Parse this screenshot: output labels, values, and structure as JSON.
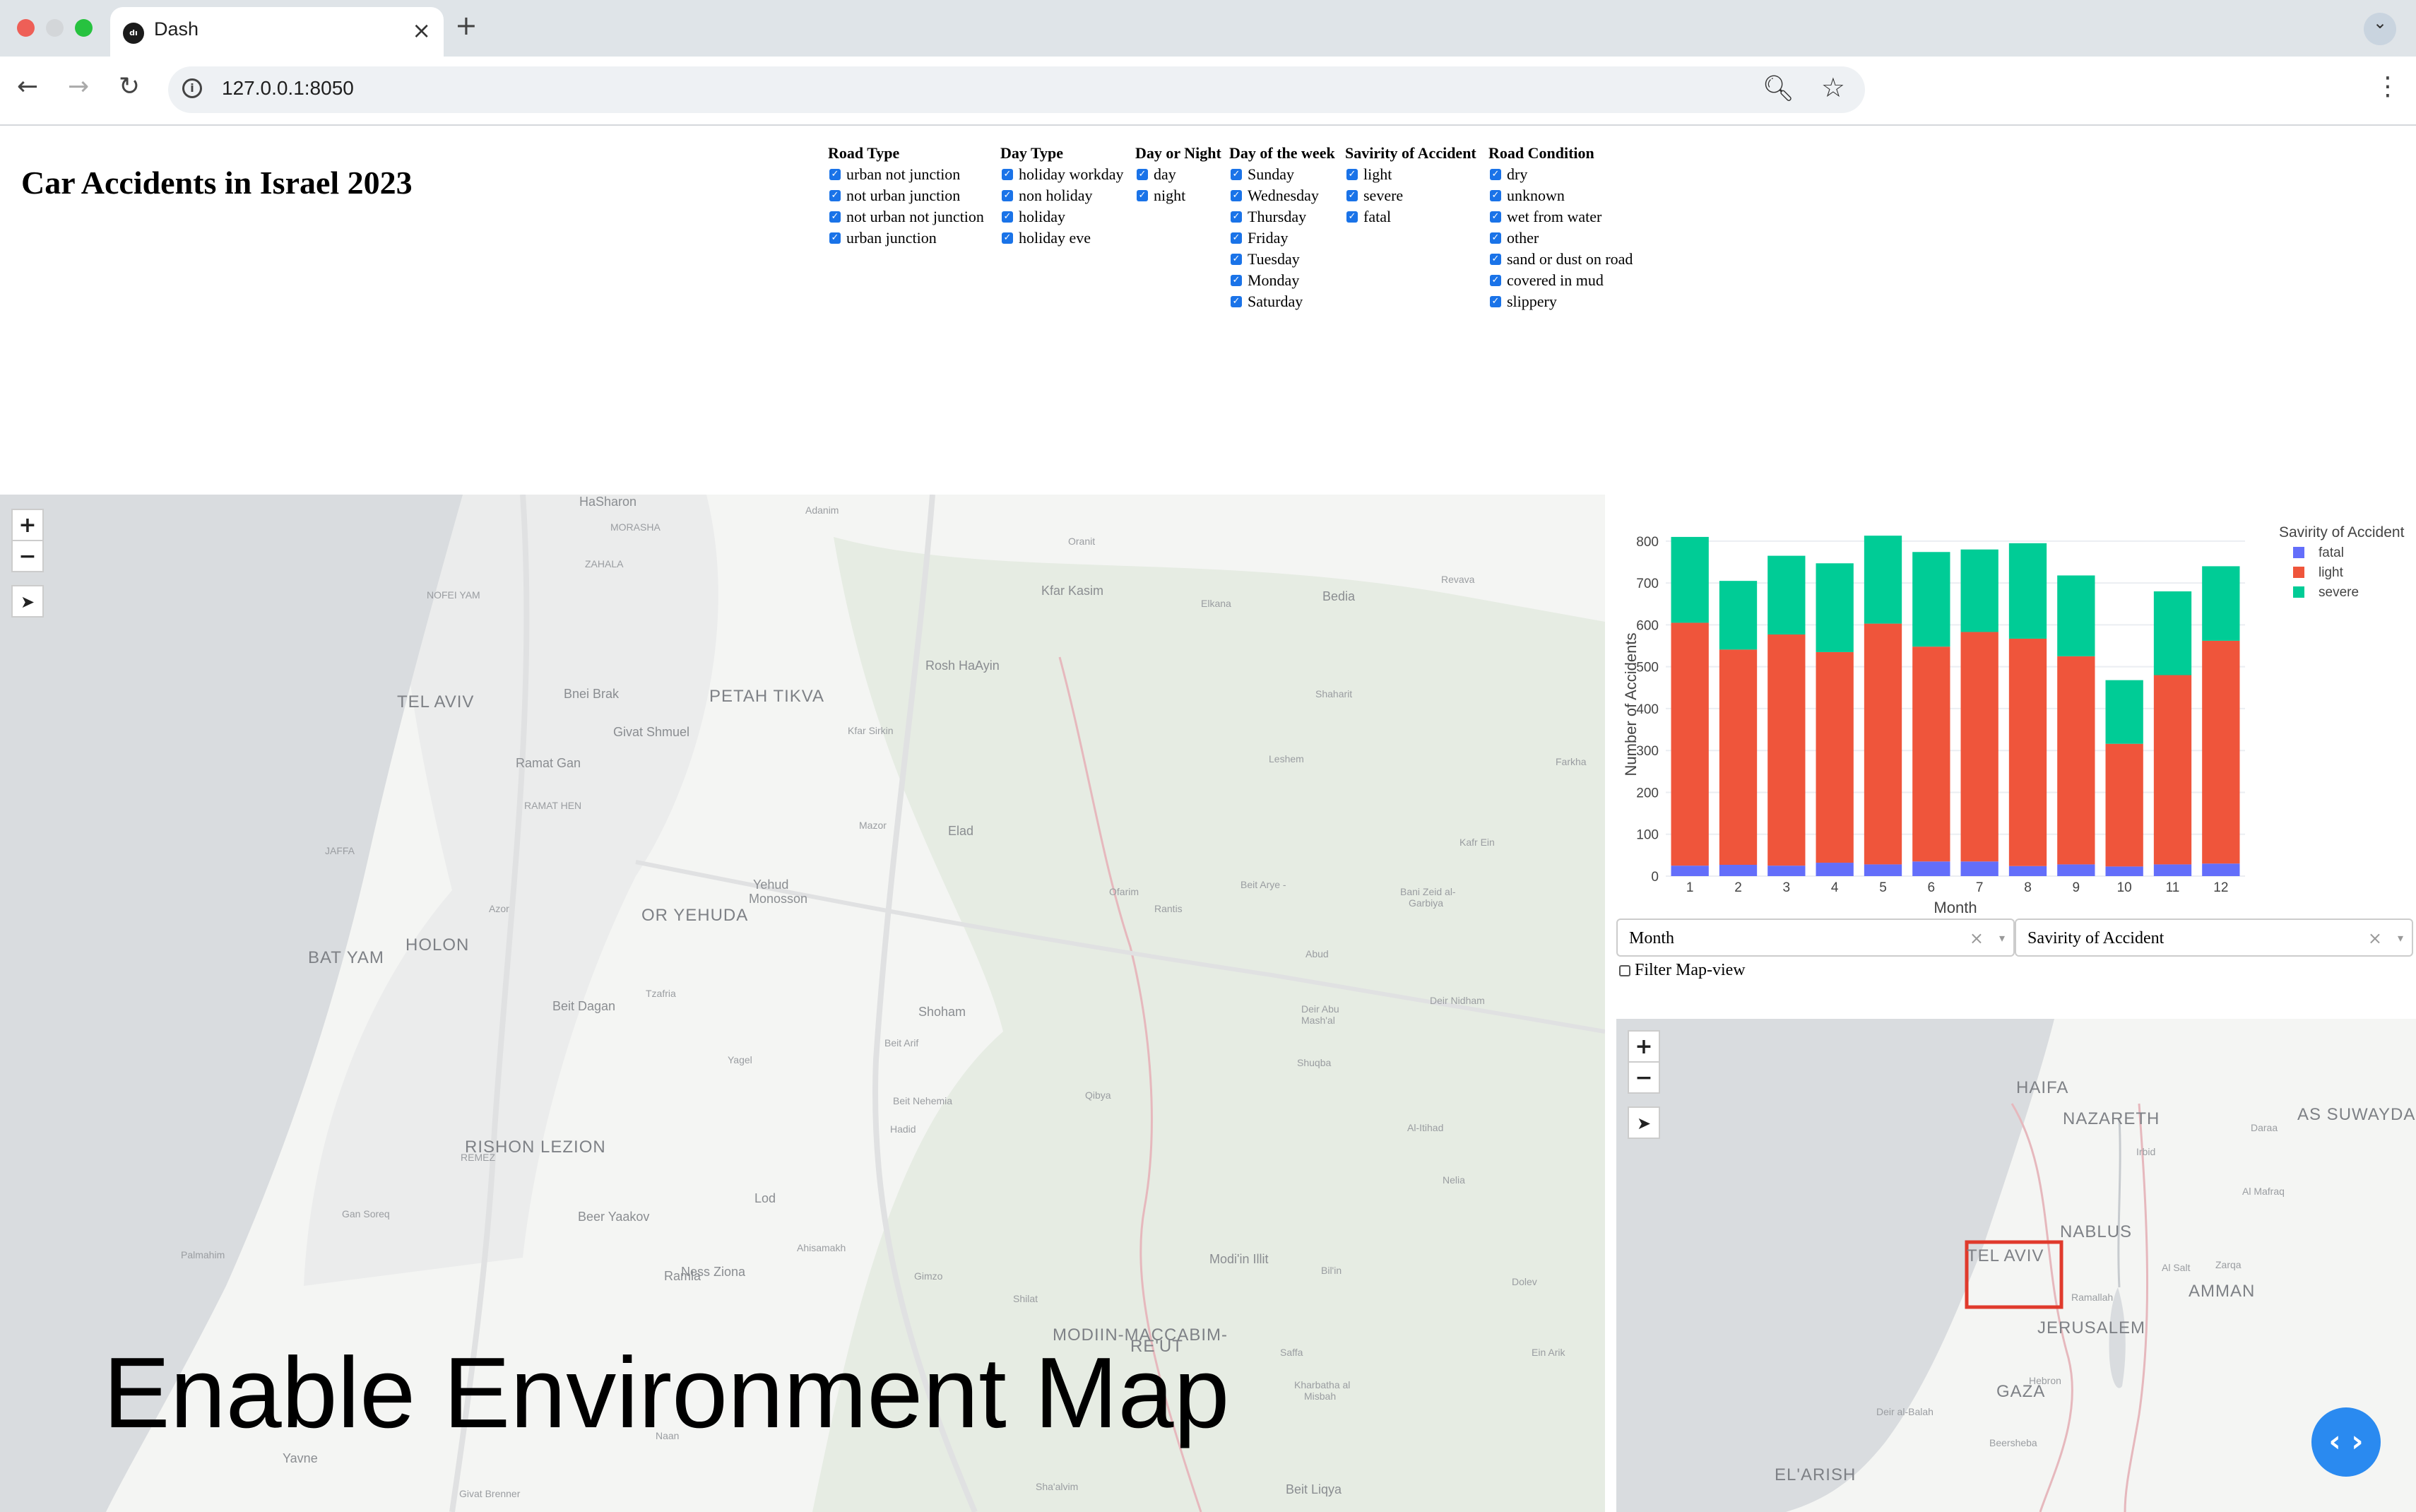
{
  "browser": {
    "tab_title": "Dash",
    "tab_close": "×",
    "new_tab": "+",
    "url": "127.0.0.1:8050"
  },
  "page": {
    "title": "Car Accidents in Israel 2023"
  },
  "filters": [
    {
      "title": "Road Type",
      "options": [
        "urban not junction",
        "not urban junction",
        "not urban not junction",
        "urban junction"
      ]
    },
    {
      "title": "Day Type",
      "options": [
        "holiday workday",
        "non holiday",
        "holiday",
        "holiday eve"
      ]
    },
    {
      "title": "Day or Night",
      "options": [
        "day",
        "night"
      ]
    },
    {
      "title": "Day of the week",
      "options": [
        "Sunday",
        "Wednesday",
        "Thursday",
        "Friday",
        "Tuesday",
        "Monday",
        "Saturday"
      ]
    },
    {
      "title": "Savirity of Accident",
      "options": [
        "light",
        "severe",
        "fatal"
      ]
    },
    {
      "title": "Road Condition",
      "options": [
        "dry",
        "unknown",
        "wet from water",
        "other",
        "sand or dust on road",
        "covered in mud",
        "slippery"
      ]
    }
  ],
  "main_map": {
    "zoom_in": "+",
    "zoom_out": "−",
    "locate": "➤",
    "land_color": "#f4f5f3",
    "sea_color": "#d9dcdf",
    "labels": [
      {
        "text": "HaSharon",
        "kind": "town"
      },
      {
        "text": "Adanim",
        "kind": "small"
      },
      {
        "text": "MORASHA",
        "kind": "small"
      },
      {
        "text": "Oranit",
        "kind": "small"
      },
      {
        "text": "ZAHALA",
        "kind": "small"
      },
      {
        "text": "Kfar Kasim",
        "kind": "town"
      },
      {
        "text": "Elkana",
        "kind": "small"
      },
      {
        "text": "Bedia",
        "kind": "town"
      },
      {
        "text": "Revava",
        "kind": "small"
      },
      {
        "text": "NOFEI YAM",
        "kind": "small"
      },
      {
        "text": "Rosh HaAyin",
        "kind": "town"
      },
      {
        "text": "TEL AVIV",
        "kind": "city"
      },
      {
        "text": "Bnei Brak",
        "kind": "town"
      },
      {
        "text": "PETAH TIKVA",
        "kind": "city"
      },
      {
        "text": "Shaharit",
        "kind": "small"
      },
      {
        "text": "Givat Shmuel",
        "kind": "town"
      },
      {
        "text": "Kfar Sirkin",
        "kind": "small"
      },
      {
        "text": "Ramat Gan",
        "kind": "town"
      },
      {
        "text": "Leshem",
        "kind": "small"
      },
      {
        "text": "Farkha",
        "kind": "small"
      },
      {
        "text": "RAMAT HEN",
        "kind": "small"
      },
      {
        "text": "Mazor",
        "kind": "small"
      },
      {
        "text": "Elad",
        "kind": "town"
      },
      {
        "text": "Kafr Ein",
        "kind": "small"
      },
      {
        "text": "JAFFA",
        "kind": "small"
      },
      {
        "text": "Yehud",
        "kind": "town"
      },
      {
        "text": "Monosson",
        "kind": "town"
      },
      {
        "text": "Beit Arye -",
        "kind": "small"
      },
      {
        "text": "Ofarim",
        "kind": "small"
      },
      {
        "text": "Bani Zeid al-",
        "kind": "small"
      },
      {
        "text": "Garbiya",
        "kind": "small"
      },
      {
        "text": "Azor",
        "kind": "small"
      },
      {
        "text": "OR YEHUDA",
        "kind": "city"
      },
      {
        "text": "Rantis",
        "kind": "small"
      },
      {
        "text": "HOLON",
        "kind": "city"
      },
      {
        "text": "BAT YAM",
        "kind": "city"
      },
      {
        "text": "Abud",
        "kind": "small"
      },
      {
        "text": "Tzafria",
        "kind": "small"
      },
      {
        "text": "Beit Dagan",
        "kind": "town"
      },
      {
        "text": "Shoham",
        "kind": "town"
      },
      {
        "text": "Deir Abu",
        "kind": "small"
      },
      {
        "text": "Mash'al",
        "kind": "small"
      },
      {
        "text": "Deir Nidham",
        "kind": "small"
      },
      {
        "text": "Beit Arif",
        "kind": "small"
      },
      {
        "text": "Yagel",
        "kind": "small"
      },
      {
        "text": "Shuqba",
        "kind": "small"
      },
      {
        "text": "Beit Nehemia",
        "kind": "small"
      },
      {
        "text": "Qibya",
        "kind": "small"
      },
      {
        "text": "Hadid",
        "kind": "small"
      },
      {
        "text": "Al-Itihad",
        "kind": "small"
      },
      {
        "text": "RISHON LEZION",
        "kind": "city"
      },
      {
        "text": "REMEZ",
        "kind": "small"
      },
      {
        "text": "Lod",
        "kind": "town"
      },
      {
        "text": "Nelia",
        "kind": "small"
      },
      {
        "text": "Gan Soreq",
        "kind": "small"
      },
      {
        "text": "Beer Yaakov",
        "kind": "town"
      },
      {
        "text": "Palmahim",
        "kind": "small"
      },
      {
        "text": "Ahisamakh",
        "kind": "small"
      },
      {
        "text": "Modi'in Illit",
        "kind": "town"
      },
      {
        "text": "Ness Ziona",
        "kind": "town"
      },
      {
        "text": "Ramla",
        "kind": "town"
      },
      {
        "text": "Gimzo",
        "kind": "small"
      },
      {
        "text": "Bil'in",
        "kind": "small"
      },
      {
        "text": "Dolev",
        "kind": "small"
      },
      {
        "text": "Shilat",
        "kind": "small"
      },
      {
        "text": "MODIIN-MACCABIM-",
        "kind": "city"
      },
      {
        "text": "RE'UT",
        "kind": "city"
      },
      {
        "text": "Saffa",
        "kind": "small"
      },
      {
        "text": "Ein Arik",
        "kind": "small"
      },
      {
        "text": "Kharbatha al",
        "kind": "small"
      },
      {
        "text": "Misbah",
        "kind": "small"
      },
      {
        "text": "Yavne",
        "kind": "town"
      },
      {
        "text": "Givat Brenner",
        "kind": "small"
      },
      {
        "text": "Sha'alvim",
        "kind": "small"
      },
      {
        "text": "Beit Liqya",
        "kind": "town"
      },
      {
        "text": "Naan",
        "kind": "small"
      }
    ]
  },
  "overlay_text": "Enable Environment Map",
  "chart_data": {
    "type": "bar",
    "stacked": true,
    "categories": [
      "1",
      "2",
      "3",
      "4",
      "5",
      "6",
      "7",
      "8",
      "9",
      "10",
      "11",
      "12"
    ],
    "series": [
      {
        "name": "fatal",
        "color": "#636efa",
        "values": [
          25,
          27,
          25,
          32,
          28,
          35,
          35,
          24,
          28,
          23,
          28,
          30
        ]
      },
      {
        "name": "light",
        "color": "#ef553b",
        "values": [
          580,
          514,
          552,
          503,
          575,
          513,
          548,
          543,
          497,
          293,
          452,
          532
        ]
      },
      {
        "name": "severe",
        "color": "#00cc96",
        "values": [
          205,
          164,
          188,
          212,
          210,
          226,
          197,
          228,
          193,
          152,
          200,
          178
        ]
      }
    ],
    "xlabel": "Month",
    "ylabel": "Number of Accidents",
    "ylim": [
      0,
      820
    ],
    "yticks": [
      0,
      100,
      200,
      300,
      400,
      500,
      600,
      700,
      800
    ],
    "legend_title": "Savirity of Accident",
    "legend_position": "top-right",
    "grid": true
  },
  "controls": {
    "x_dropdown": {
      "value": "Month",
      "clear": "×",
      "arrow": "▾"
    },
    "color_dropdown": {
      "value": "Savirity of Accident",
      "clear": "×",
      "arrow": "▾"
    },
    "filter_label": "Filter Map-view"
  },
  "mini_map": {
    "zoom_in": "+",
    "zoom_out": "−",
    "locate": "➤",
    "highlight_color": "#e03a2c",
    "labels": [
      {
        "text": "HAIFA",
        "kind": "city"
      },
      {
        "text": "NAZARETH",
        "kind": "city"
      },
      {
        "text": "AS SUWAYDA",
        "kind": "city"
      },
      {
        "text": "Irbid",
        "kind": "small"
      },
      {
        "text": "Daraa",
        "kind": "small"
      },
      {
        "text": "Al Mafraq",
        "kind": "small"
      },
      {
        "text": "NABLUS",
        "kind": "city"
      },
      {
        "text": "TEL AVIV",
        "kind": "city"
      },
      {
        "text": "Al Salt",
        "kind": "small"
      },
      {
        "text": "Zarqa",
        "kind": "small"
      },
      {
        "text": "AMMAN",
        "kind": "city"
      },
      {
        "text": "Ramallah",
        "kind": "small"
      },
      {
        "text": "JERUSALEM",
        "kind": "city"
      },
      {
        "text": "GAZA",
        "kind": "city"
      },
      {
        "text": "Hebron",
        "kind": "small"
      },
      {
        "text": "Deir al-Balah",
        "kind": "small"
      },
      {
        "text": "Beersheba",
        "kind": "small"
      },
      {
        "text": "EL'ARISH",
        "kind": "city"
      }
    ]
  },
  "dash_button": "‹ ›"
}
